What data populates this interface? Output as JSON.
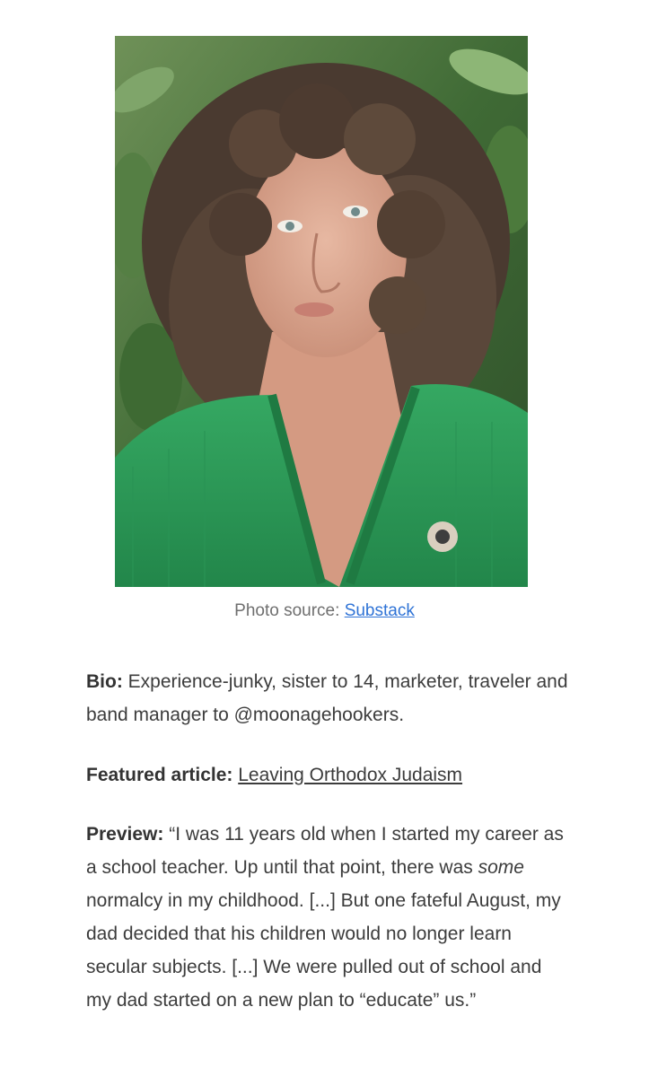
{
  "photo": {
    "alt_icon": "portrait-photo",
    "colors": {
      "foliage": "#4f7a3e",
      "sweater": "#2f9a5a",
      "hair": "#4a3a30",
      "skin": "#d9a38c"
    }
  },
  "caption": {
    "prefix": "Photo source: ",
    "link": "Substack"
  },
  "bio": {
    "label": "Bio:",
    "text": " Experience-junky, sister to 14, marketer, traveler and band manager to @moonagehookers."
  },
  "featured": {
    "label": "Featured article:",
    "link": "Leaving Orthodox Judaism"
  },
  "preview": {
    "label": "Preview:",
    "text_before": " “I was 11 years old when I started my career as a school teacher. Up until that point, there was ",
    "emphasis": "some",
    "text_after": " normalcy in my childhood. [...] But one fateful August, my dad decided that his children would no longer learn secular subjects. [...] We were pulled out of school and my dad started on a new plan to “educate” us.”"
  }
}
